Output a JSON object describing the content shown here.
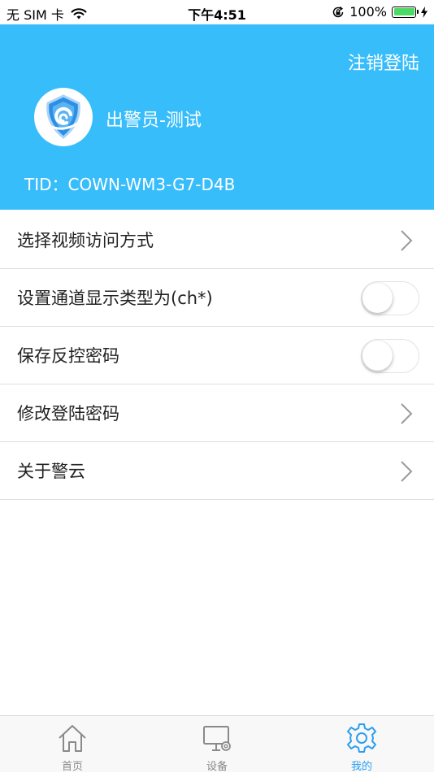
{
  "status_bar": {
    "carrier": "无 SIM 卡",
    "time": "下午4:51",
    "battery_percent": "100%"
  },
  "header": {
    "logout_label": "注销登陆",
    "username": "出警员-测试",
    "tid": "TID：COWN-WM3-G7-D4B",
    "background_color": "#38bdfb"
  },
  "menu": {
    "items": [
      {
        "label": "选择视频访问方式",
        "control": "chevron"
      },
      {
        "label": "设置通道显示类型为(ch*)",
        "control": "toggle",
        "on": false
      },
      {
        "label": "保存反控密码",
        "control": "toggle",
        "on": false
      },
      {
        "label": "修改登陆密码",
        "control": "chevron"
      },
      {
        "label": "关于警云",
        "control": "chevron"
      }
    ]
  },
  "tab_bar": {
    "tabs": [
      {
        "label": "首页",
        "icon": "home-icon",
        "active": false
      },
      {
        "label": "设备",
        "icon": "device-icon",
        "active": false
      },
      {
        "label": "我的",
        "icon": "gear-icon",
        "active": true
      }
    ],
    "active_color": "#2a9ff0"
  }
}
